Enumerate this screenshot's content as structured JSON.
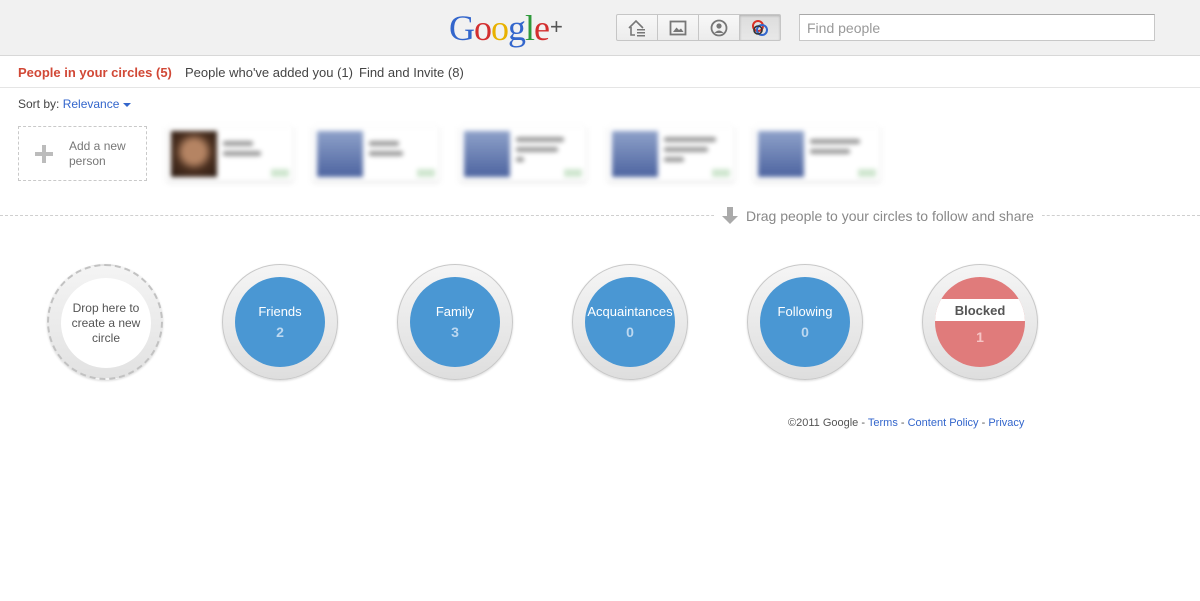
{
  "header": {
    "logo": {
      "g": "G",
      "o1": "o",
      "o2": "o",
      "g2": "g",
      "l": "l",
      "e": "e",
      "plus": "+"
    },
    "nav": [
      {
        "name": "home-nav-button",
        "icon": "home-stream-icon"
      },
      {
        "name": "photos-nav-button",
        "icon": "photos-icon"
      },
      {
        "name": "profile-nav-button",
        "icon": "profile-icon"
      },
      {
        "name": "circles-nav-button",
        "icon": "circles-icon",
        "active": true
      }
    ],
    "search_placeholder": "Find people"
  },
  "tabs": [
    {
      "label": "People in your circles (5)",
      "active": true
    },
    {
      "label": "People who've added you (1)",
      "active": false
    },
    {
      "label": "Find and Invite (8)",
      "active": false
    }
  ],
  "sort": {
    "label": "Sort by:",
    "value": "Relevance"
  },
  "add_person": {
    "label": "Add a new person"
  },
  "drag_hint": "Drag people to your circles to follow and share",
  "circles": [
    {
      "label": "Drop here to create a new circle",
      "type": "new"
    },
    {
      "label": "Friends",
      "count": "2",
      "type": "normal"
    },
    {
      "label": "Family",
      "count": "3",
      "type": "normal"
    },
    {
      "label": "Acquaintances",
      "count": "0",
      "type": "normal"
    },
    {
      "label": "Following",
      "count": "0",
      "type": "normal"
    },
    {
      "label": "Blocked",
      "count": "1",
      "type": "blocked"
    }
  ],
  "footer": {
    "copyright": "©2011 Google",
    "sep1": " - ",
    "terms": "Terms",
    "sep2": " - ",
    "content_policy": "Content Policy",
    "sep3": " - ",
    "privacy": "Privacy"
  },
  "colors": {
    "accent_red": "#d14836",
    "link_blue": "#3366cc",
    "circle_blue": "#4a97d3",
    "blocked_red": "#e07b7b"
  }
}
